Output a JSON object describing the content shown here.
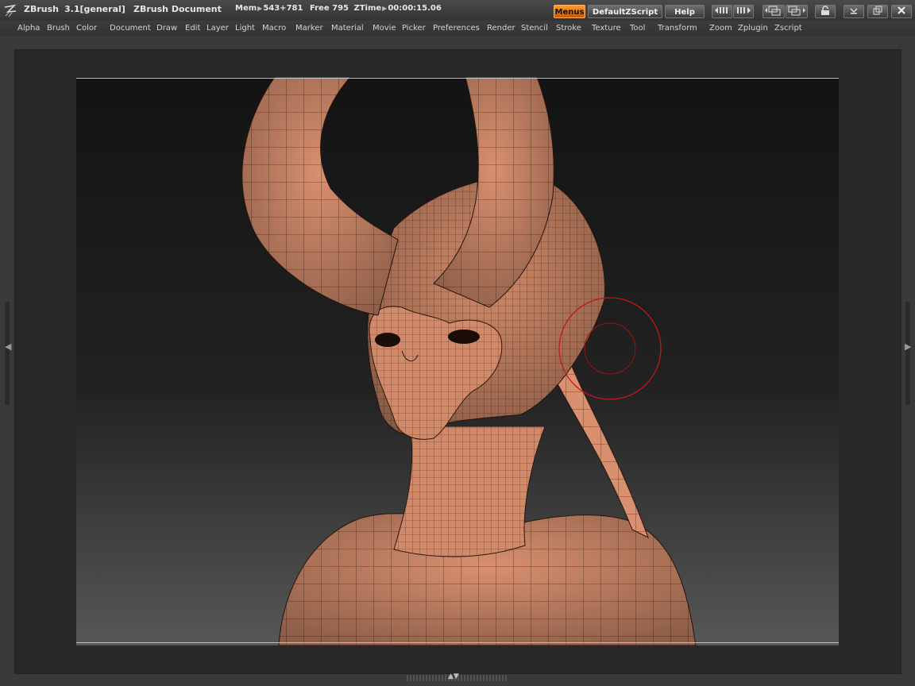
{
  "title": {
    "app_name": "ZBrush",
    "version": "3.1[general]",
    "document": "ZBrush Document",
    "mem_label": "Mem",
    "mem_value": "543+781",
    "free_label": "Free",
    "free_value": "795",
    "ztime_label": "ZTime",
    "ztime_value": "00:00:15.06"
  },
  "top_buttons": {
    "menus": "Menus",
    "default_zscript": "DefaultZScript",
    "help": "Help"
  },
  "menu_items": [
    "Alpha",
    "Brush",
    "Color",
    "Document",
    "Draw",
    "Edit",
    "Layer",
    "Light",
    "Macro",
    "Marker",
    "Material",
    "Movie",
    "Picker",
    "Preferences",
    "Render",
    "Stencil",
    "Stroke",
    "Texture",
    "Tool",
    "Transform",
    "Zoom",
    "Zplugin",
    "Zscript"
  ],
  "colors": {
    "accent_orange": "#f08a24",
    "model_skin": "#d9906f",
    "brush_cursor": "#c01818"
  },
  "icons": {
    "logo": "zbrush-logo-icon",
    "minimize": "minimize-icon",
    "restore": "restore-icon",
    "close": "close-icon"
  }
}
